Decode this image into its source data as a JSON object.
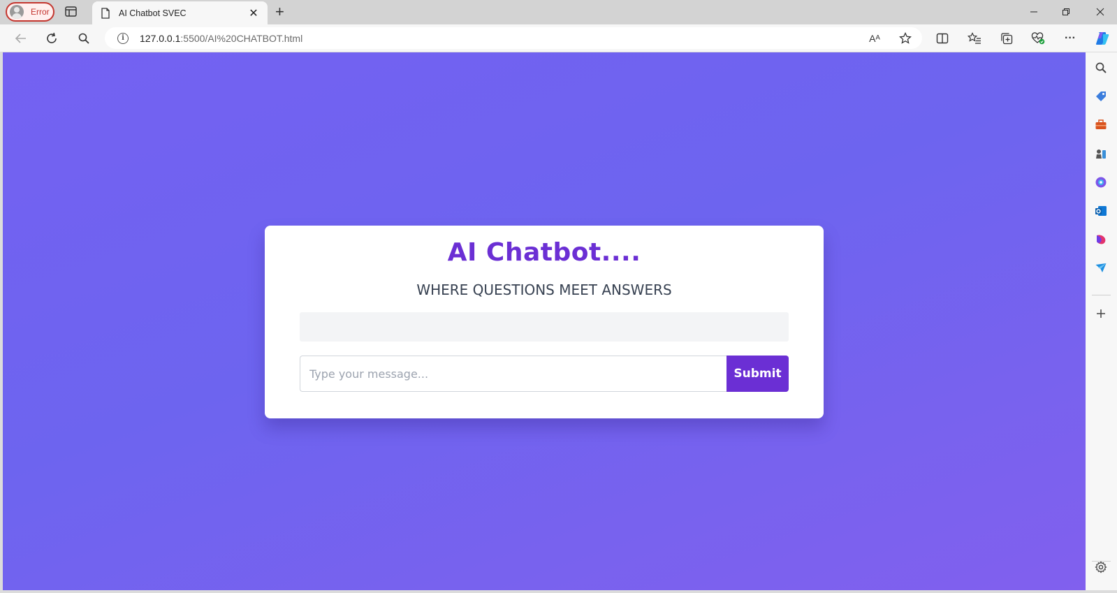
{
  "browser": {
    "profile_label": "Error",
    "tab_title": "AI Chatbot SVEC",
    "url_host": "127.0.0.1",
    "url_path": ":5500/AI%20CHATBOT.html",
    "read_aloud_label": "Aᴬ",
    "more_label": "···"
  },
  "page": {
    "title": "AI Chatbot....",
    "subtitle": "WHERE QUESTIONS MEET ANSWERS",
    "message_placeholder": "Type your message...",
    "submit_label": "Submit"
  },
  "colors": {
    "accent": "#6b2fd4",
    "background_start": "#7461f2",
    "background_end": "#8160ee",
    "error": "#c4362f"
  },
  "sidebar_icons": [
    "search-icon",
    "shopping-tag-icon",
    "toolbox-icon",
    "chess-icon",
    "copilot-icon",
    "outlook-icon",
    "designer-icon",
    "send-icon",
    "add-icon",
    "settings-icon"
  ]
}
